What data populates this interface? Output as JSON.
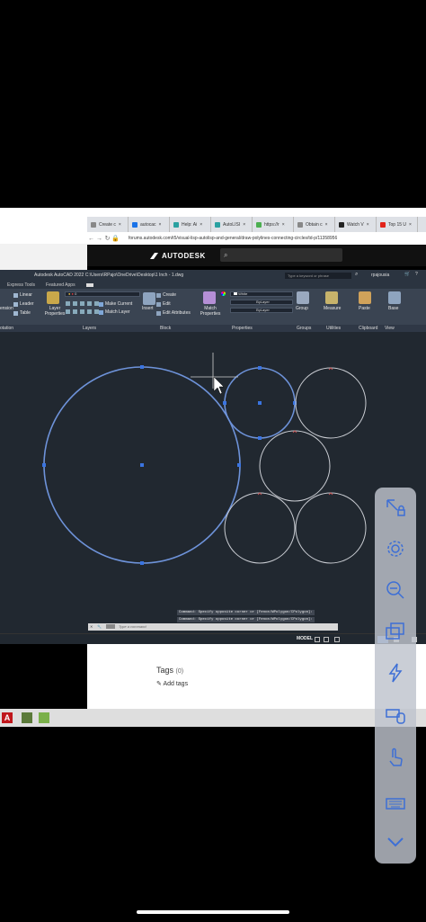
{
  "browser": {
    "tabs": [
      {
        "label": "Create c",
        "color": "#888888"
      },
      {
        "label": "autocac",
        "color": "#1a73e8"
      },
      {
        "label": "Help: Ai",
        "color": "#2aa1a1"
      },
      {
        "label": "AutoLISI",
        "color": "#2aa1a1"
      },
      {
        "label": "https://r",
        "color": "#4caf50"
      },
      {
        "label": "Obtain c",
        "color": "#888888"
      },
      {
        "label": "Watch V",
        "color": "#222222"
      },
      {
        "label": "Top 15 U",
        "color": "#e2231a"
      }
    ],
    "url": "forums.autodesk.com/t5/visual-lisp-autolisp-and-general/draw-polylines-connecting-circles/td-p/11358956"
  },
  "site": {
    "logo": "AUTODESK",
    "search_icon": "search-icon"
  },
  "autocad": {
    "title": "Autodesk AutoCAD 2022   C:\\Users\\RPajo\\OneDrive\\Desktop\\1 Inch - 1.dwg",
    "search_placeholder": "Type a keyword or phrase",
    "user": "rpajousia",
    "menu": [
      "Express Tools",
      "Featured Apps"
    ],
    "ribbon": {
      "linear": "Linear",
      "leader": "Leader",
      "table": "Table",
      "dimension": "ension",
      "layer_properties": "Layer Properties",
      "layer_value": "0",
      "make_current": "Make Current",
      "match_layer": "Match Layer",
      "insert": "Insert",
      "create": "Create",
      "edit": "Edit",
      "edit_attributes": "Edit Attributes",
      "match_properties": "Match Properties",
      "color": "White",
      "linetype": "ByLayer",
      "lineweight": "ByLayer",
      "group": "Group",
      "measure": "Measure",
      "paste": "Paste",
      "base": "Base"
    },
    "panels": [
      "otation",
      "Layers",
      "Block",
      "Properties",
      "Groups",
      "Utilities",
      "Clipboard",
      "View"
    ],
    "command_history": [
      "Command: Specify opposite corner or [Fence/WPolygon/CPolygon]:",
      "Command: Specify opposite corner or [Fence/WPolygon/CPolygon]:"
    ],
    "command_placeholder": "Type a command",
    "model_label": "MODEL"
  },
  "forum": {
    "tags_label": "Tags",
    "tags_count": "(0)",
    "add_tags": "Add tags"
  },
  "side_toolbar": {
    "icons": [
      "pointer-lock-icon",
      "gear-icon",
      "zoom-out-icon",
      "windows-icon",
      "lightning-icon",
      "keyboard-mouse-icon",
      "touch-icon",
      "keyboard-icon",
      "chevron-down-icon"
    ]
  }
}
